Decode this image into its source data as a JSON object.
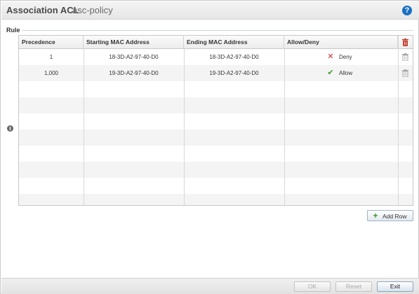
{
  "header": {
    "title": "Association ACL",
    "subtitle": "asc-policy",
    "help_icon": "help-icon"
  },
  "section": {
    "label": "Rule",
    "info_icon": "info-icon"
  },
  "table": {
    "columns": [
      "Precedence",
      "Starting MAC Address",
      "Ending MAC Address",
      "Allow/Deny"
    ],
    "header_action_icon": "trash-icon-red",
    "rows": [
      {
        "precedence": "1",
        "start_mac": "18-3D-A2-97-40-D0",
        "end_mac": "18-3D-A2-97-40-D0",
        "action": "Deny",
        "action_icon": "x-icon"
      },
      {
        "precedence": "1,000",
        "start_mac": "19-3D-A2-97-40-D0",
        "end_mac": "19-3D-A2-97-40-D0",
        "action": "Allow",
        "action_icon": "check-icon"
      }
    ]
  },
  "add_row": {
    "label": "Add Row",
    "icon": "plus-icon"
  },
  "footer": {
    "ok_label": "OK",
    "reset_label": "Reset",
    "exit_label": "Exit"
  },
  "colors": {
    "deny": "#d42a2a",
    "allow": "#3e9a2e",
    "help": "#1a6fc2",
    "delete_all": "#c0392b"
  }
}
